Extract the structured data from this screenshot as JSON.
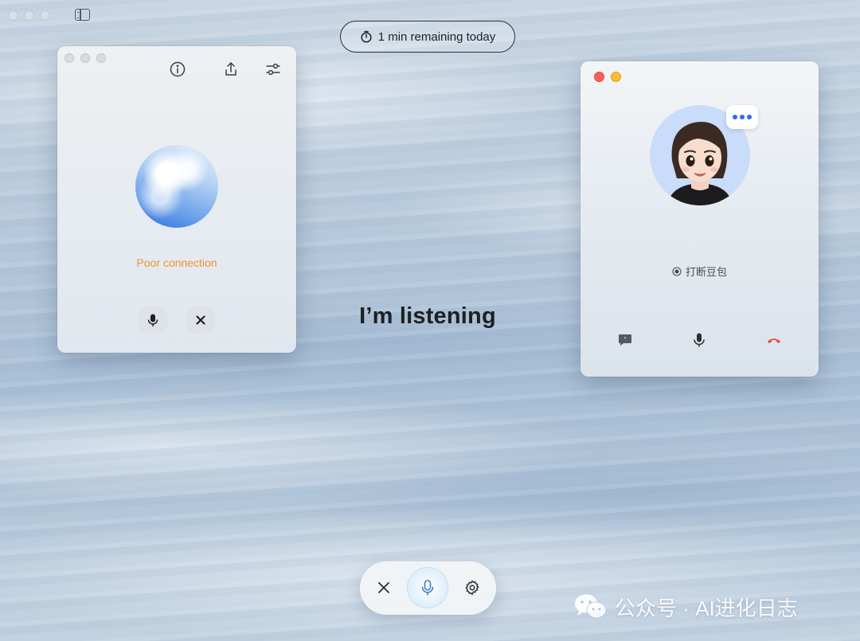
{
  "timer": {
    "label": "1 min remaining today",
    "icon": "stopwatch-icon"
  },
  "left_panel": {
    "status": "Poor connection",
    "status_color": "#f0932b",
    "toolbar_icons": [
      "info-icon",
      "share-icon",
      "sliders-icon"
    ],
    "controls": [
      "microphone-icon",
      "close-icon"
    ]
  },
  "center": {
    "listening_text": "I’m listening"
  },
  "right_panel": {
    "interrupt_label": "打断豆包",
    "typing_dots_color": "#2f6df0",
    "controls": [
      "chat-bubble-icon",
      "microphone-icon",
      "hang-up-icon"
    ],
    "hangup_color": "#e5483f"
  },
  "bottom_bar": {
    "buttons": [
      "close-icon",
      "microphone-icon",
      "gear-icon"
    ],
    "mic_color": "#3b82c8"
  },
  "watermark": {
    "text": "公众号 · AI进化日志",
    "icon": "wechat-icon"
  }
}
